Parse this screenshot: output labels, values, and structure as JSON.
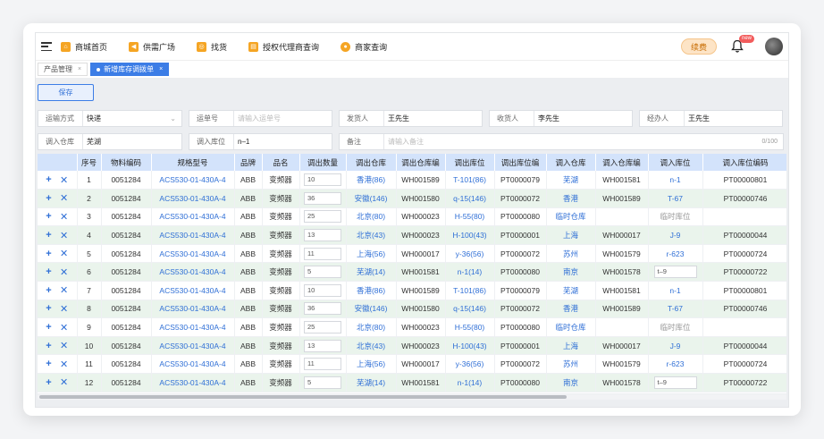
{
  "topbar": {
    "nav": [
      {
        "label": "商城首页",
        "icon": "home-icon",
        "color": "#f5a524"
      },
      {
        "label": "供需广场",
        "icon": "megaphone-icon",
        "color": "#f5a524"
      },
      {
        "label": "找货",
        "icon": "cart-icon",
        "color": "#f5a524"
      },
      {
        "label": "授权代理商查询",
        "icon": "document-icon",
        "color": "#f5a524"
      },
      {
        "label": "商家查询",
        "icon": "shop-icon",
        "color": "#f5a524"
      }
    ],
    "renew_label": "续费",
    "new_badge": "new"
  },
  "tabs": [
    {
      "label": "产品管理",
      "active": false
    },
    {
      "label": "新增库存调拨单",
      "active": true
    }
  ],
  "save_label": "保存",
  "form": {
    "row1": [
      {
        "label": "运输方式",
        "value": "快递",
        "type": "select"
      },
      {
        "label": "运单号",
        "placeholder": "请输入运单号"
      },
      {
        "label": "发货人",
        "value": "王先生"
      },
      {
        "label": "收货人",
        "value": "李先生"
      },
      {
        "label": "经办人",
        "value": "王先生"
      }
    ],
    "row2": [
      {
        "label": "调入仓库",
        "value": "芜湖"
      },
      {
        "label": "调入库位",
        "value": "n–1"
      }
    ],
    "remark": {
      "label": "备注",
      "placeholder": "请输入备注",
      "counter": "0/100"
    }
  },
  "table": {
    "headers": [
      "",
      "序号",
      "物料编码",
      "规格型号",
      "品牌",
      "品名",
      "调出数量",
      "调出仓库",
      "调出仓库编",
      "调出库位",
      "调出库位编",
      "调入仓库",
      "调入仓库编",
      "调入库位",
      "调入库位编码"
    ],
    "rows": [
      {
        "no": "1",
        "code": "0051284",
        "model": "ACS530-01-430A-4",
        "brand": "ABB",
        "name": "变频器",
        "qty": "10",
        "out_wh": "香港(86)",
        "out_wh_code": "WH001589",
        "out_loc": "T-101(86)",
        "out_loc_code": "PT0000079",
        "in_wh": "芜湖",
        "in_wh_code": "WH001581",
        "in_loc": "n-1",
        "in_loc_input": false,
        "in_loc_code": "PT00000801"
      },
      {
        "no": "2",
        "code": "0051284",
        "model": "ACS530-01-430A-4",
        "brand": "ABB",
        "name": "变频器",
        "qty": "36",
        "out_wh": "安徽(146)",
        "out_wh_code": "WH001580",
        "out_loc": "q-15(146)",
        "out_loc_code": "PT0000072",
        "in_wh": "香港",
        "in_wh_code": "WH001589",
        "in_loc": "T-67",
        "in_loc_input": false,
        "in_loc_code": "PT00000746"
      },
      {
        "no": "3",
        "code": "0051284",
        "model": "ACS530-01-430A-4",
        "brand": "ABB",
        "name": "变频器",
        "qty": "25",
        "out_wh": "北京(80)",
        "out_wh_code": "WH000023",
        "out_loc": "H-55(80)",
        "out_loc_code": "PT0000080",
        "in_wh": "临时仓库",
        "in_wh_code": "",
        "in_loc": "临时库位",
        "in_loc_input": false,
        "in_loc_gray": true,
        "in_loc_code": ""
      },
      {
        "no": "4",
        "code": "0051284",
        "model": "ACS530-01-430A-4",
        "brand": "ABB",
        "name": "变频器",
        "qty": "13",
        "out_wh": "北京(43)",
        "out_wh_code": "WH000023",
        "out_loc": "H-100(43)",
        "out_loc_code": "PT0000001",
        "in_wh": "上海",
        "in_wh_code": "WH000017",
        "in_loc": "J-9",
        "in_loc_input": false,
        "in_loc_code": "PT00000044"
      },
      {
        "no": "5",
        "code": "0051284",
        "model": "ACS530-01-430A-4",
        "brand": "ABB",
        "name": "变频器",
        "qty": "11",
        "out_wh": "上海(56)",
        "out_wh_code": "WH000017",
        "out_loc": "y-36(56)",
        "out_loc_code": "PT0000072",
        "in_wh": "苏州",
        "in_wh_code": "WH001579",
        "in_loc": "r-623",
        "in_loc_input": false,
        "in_loc_code": "PT00000724"
      },
      {
        "no": "6",
        "code": "0051284",
        "model": "ACS530-01-430A-4",
        "brand": "ABB",
        "name": "变频器",
        "qty": "5",
        "out_wh": "芜湖(14)",
        "out_wh_code": "WH001581",
        "out_loc": "n-1(14)",
        "out_loc_code": "PT0000080",
        "in_wh": "南京",
        "in_wh_code": "WH001578",
        "in_loc": "t–9",
        "in_loc_input": true,
        "in_loc_code": "PT00000722"
      },
      {
        "no": "7",
        "code": "0051284",
        "model": "ACS530-01-430A-4",
        "brand": "ABB",
        "name": "变频器",
        "qty": "10",
        "out_wh": "香港(86)",
        "out_wh_code": "WH001589",
        "out_loc": "T-101(86)",
        "out_loc_code": "PT0000079",
        "in_wh": "芜湖",
        "in_wh_code": "WH001581",
        "in_loc": "n-1",
        "in_loc_input": false,
        "in_loc_code": "PT00000801"
      },
      {
        "no": "8",
        "code": "0051284",
        "model": "ACS530-01-430A-4",
        "brand": "ABB",
        "name": "变频器",
        "qty": "36",
        "out_wh": "安徽(146)",
        "out_wh_code": "WH001580",
        "out_loc": "q-15(146)",
        "out_loc_code": "PT0000072",
        "in_wh": "香港",
        "in_wh_code": "WH001589",
        "in_loc": "T-67",
        "in_loc_input": false,
        "in_loc_code": "PT00000746"
      },
      {
        "no": "9",
        "code": "0051284",
        "model": "ACS530-01-430A-4",
        "brand": "ABB",
        "name": "变频器",
        "qty": "25",
        "out_wh": "北京(80)",
        "out_wh_code": "WH000023",
        "out_loc": "H-55(80)",
        "out_loc_code": "PT0000080",
        "in_wh": "临时仓库",
        "in_wh_code": "",
        "in_loc": "临时库位",
        "in_loc_input": false,
        "in_loc_gray": true,
        "in_loc_code": ""
      },
      {
        "no": "10",
        "code": "0051284",
        "model": "ACS530-01-430A-4",
        "brand": "ABB",
        "name": "变频器",
        "qty": "13",
        "out_wh": "北京(43)",
        "out_wh_code": "WH000023",
        "out_loc": "H-100(43)",
        "out_loc_code": "PT0000001",
        "in_wh": "上海",
        "in_wh_code": "WH000017",
        "in_loc": "J-9",
        "in_loc_input": false,
        "in_loc_code": "PT00000044"
      },
      {
        "no": "11",
        "code": "0051284",
        "model": "ACS530-01-430A-4",
        "brand": "ABB",
        "name": "变频器",
        "qty": "11",
        "out_wh": "上海(56)",
        "out_wh_code": "WH000017",
        "out_loc": "y-36(56)",
        "out_loc_code": "PT0000072",
        "in_wh": "苏州",
        "in_wh_code": "WH001579",
        "in_loc": "r-623",
        "in_loc_input": false,
        "in_loc_code": "PT00000724"
      },
      {
        "no": "12",
        "code": "0051284",
        "model": "ACS530-01-430A-4",
        "brand": "ABB",
        "name": "变频器",
        "qty": "5",
        "out_wh": "芜湖(14)",
        "out_wh_code": "WH001581",
        "out_loc": "n-1(14)",
        "out_loc_code": "PT0000080",
        "in_wh": "南京",
        "in_wh_code": "WH001578",
        "in_loc": "t–9",
        "in_loc_input": true,
        "in_loc_code": "PT00000722"
      }
    ]
  },
  "colors": {
    "accent": "#3c7de6",
    "header_bg": "#d3e3fb",
    "row_alt": "#eaf4ec",
    "renew_bg": "#fde4c6",
    "badge": "#f25c5c"
  }
}
